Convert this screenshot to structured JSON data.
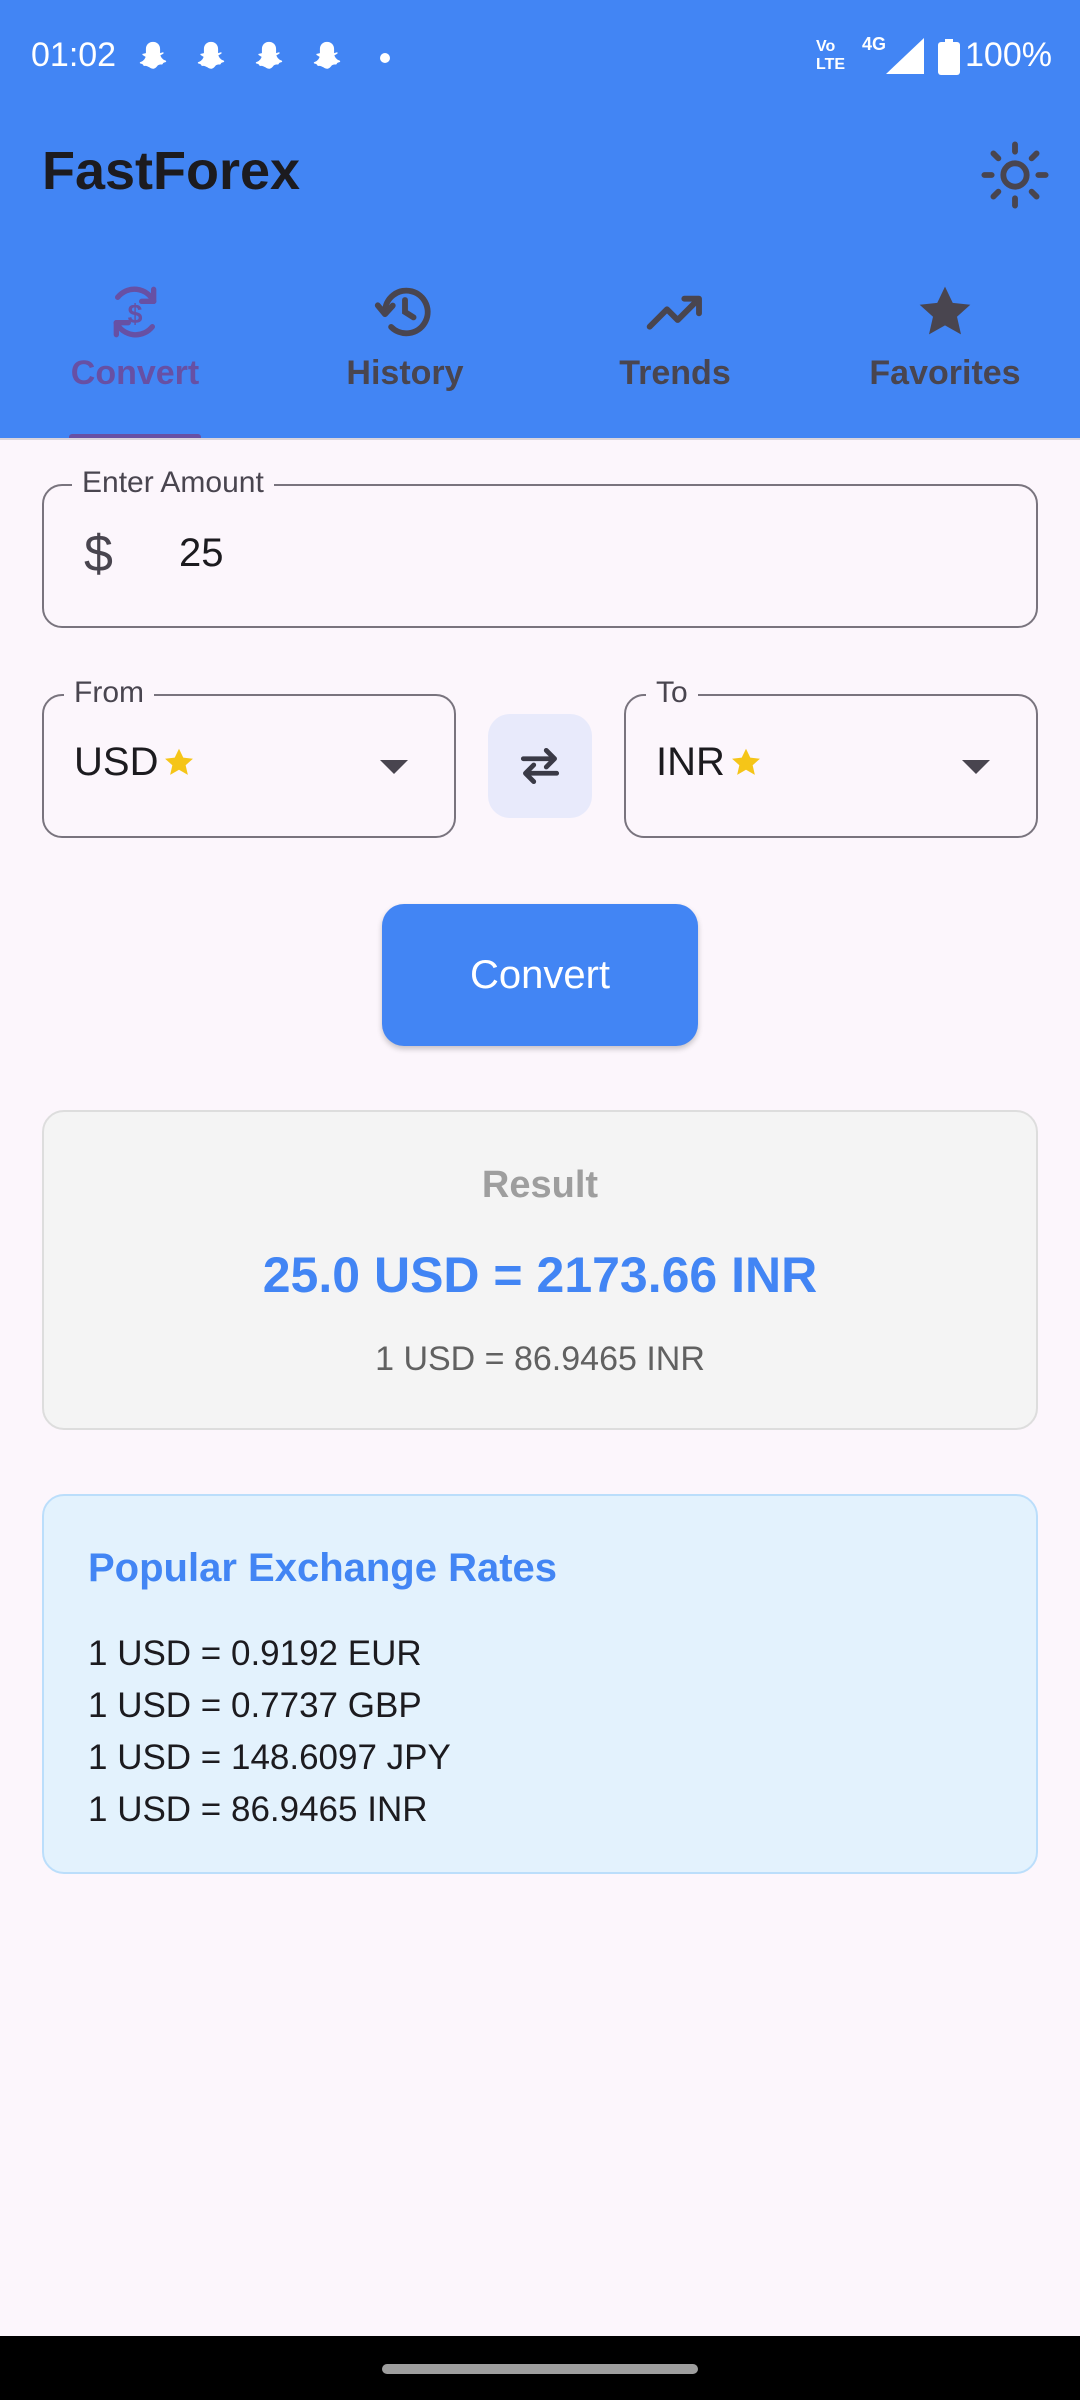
{
  "status_bar": {
    "time": "01:02",
    "network": "Vo\nLTE",
    "signal_label": "4G",
    "battery": "100%",
    "notification_icons": [
      "snapchat-icon",
      "snapchat-icon",
      "snapchat-icon",
      "snapchat-icon"
    ]
  },
  "app": {
    "title": "FastForex",
    "theme_icon": "sun-icon",
    "accent_color": "#4285f4",
    "active_tab_color": "#6750a4"
  },
  "tabs": [
    {
      "label": "Convert",
      "icon": "currency-exchange-icon",
      "active": true
    },
    {
      "label": "History",
      "icon": "history-icon",
      "active": false
    },
    {
      "label": "Trends",
      "icon": "trending-up-icon",
      "active": false
    },
    {
      "label": "Favorites",
      "icon": "star-icon",
      "active": false
    }
  ],
  "amount": {
    "label": "Enter Amount",
    "prefix": "$",
    "value": "25"
  },
  "from": {
    "label": "From",
    "value": "USD",
    "favorite": true
  },
  "to": {
    "label": "To",
    "value": "INR",
    "favorite": true
  },
  "swap_icon": "swap-horizontal-icon",
  "convert_button": "Convert",
  "result": {
    "label": "Result",
    "main": "25.0 USD = 2173.66 INR",
    "rate": "1 USD = 86.9465 INR"
  },
  "popular": {
    "title": "Popular Exchange Rates",
    "items": [
      "1 USD = 0.9192 EUR",
      "1 USD = 0.7737 GBP",
      "1 USD = 148.6097 JPY",
      "1 USD = 86.9465 INR"
    ]
  }
}
